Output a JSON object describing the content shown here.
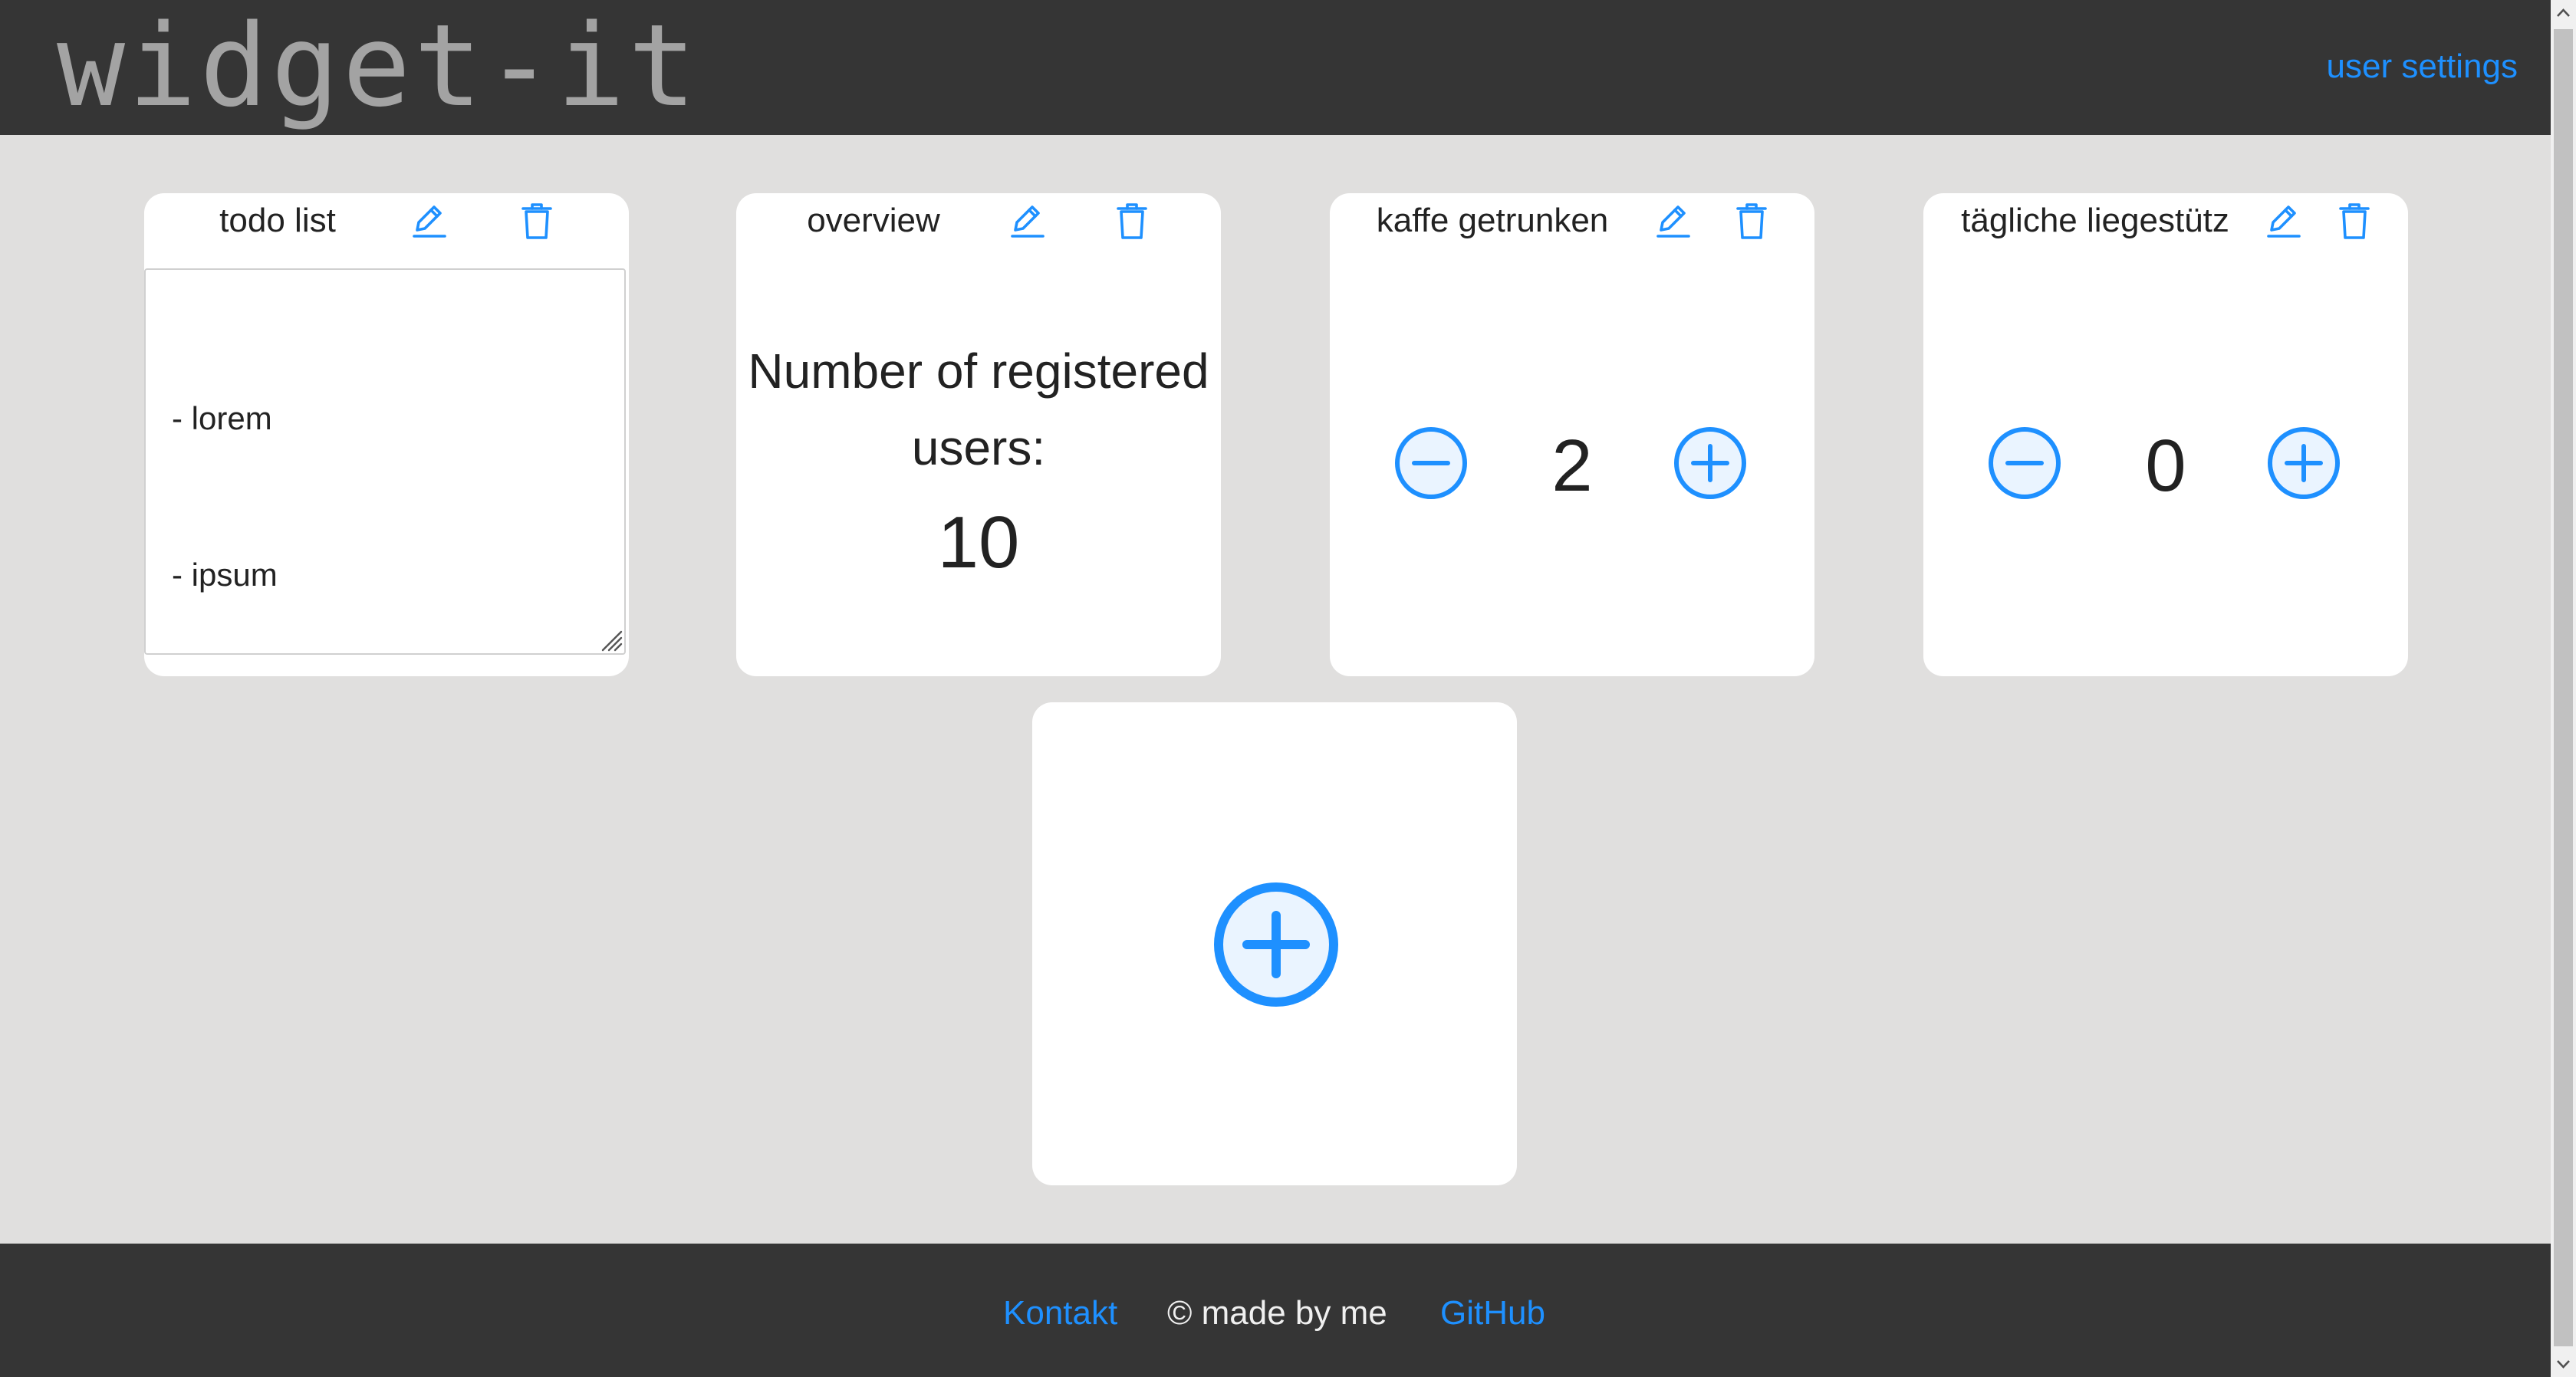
{
  "header": {
    "logo_text": "widget-it",
    "user_settings_label": "user settings"
  },
  "widgets": [
    {
      "title": "todo list",
      "type": "todo",
      "lines": [
        "- lorem",
        "- ipsum"
      ],
      "edit_icon": "pencil-icon",
      "delete_icon": "trash-icon"
    },
    {
      "title": "overview",
      "type": "overview",
      "label": "Number of registered users:",
      "label_line1": "Number of registered",
      "label_line2": "users:",
      "value": "10",
      "edit_icon": "pencil-icon",
      "delete_icon": "trash-icon"
    },
    {
      "title": "kaffe getrunken",
      "type": "counter",
      "value": "2",
      "decrement_icon": "minus-circle-icon",
      "increment_icon": "plus-circle-icon",
      "edit_icon": "pencil-icon",
      "delete_icon": "trash-icon"
    },
    {
      "title": "tägliche liegestütz",
      "type": "counter",
      "value": "0",
      "decrement_icon": "minus-circle-icon",
      "increment_icon": "plus-circle-icon",
      "edit_icon": "pencil-icon",
      "delete_icon": "trash-icon"
    }
  ],
  "add_widget": {
    "icon": "plus-circle-icon"
  },
  "footer": {
    "contact_label": "Kontakt",
    "copyright_text": "© made by me",
    "github_label": "GitHub"
  },
  "colors": {
    "accent": "#1e90ff",
    "header_bg": "#353535",
    "page_bg": "#e0dfde",
    "card_bg": "#ffffff",
    "logo": "#a3a3a3"
  }
}
